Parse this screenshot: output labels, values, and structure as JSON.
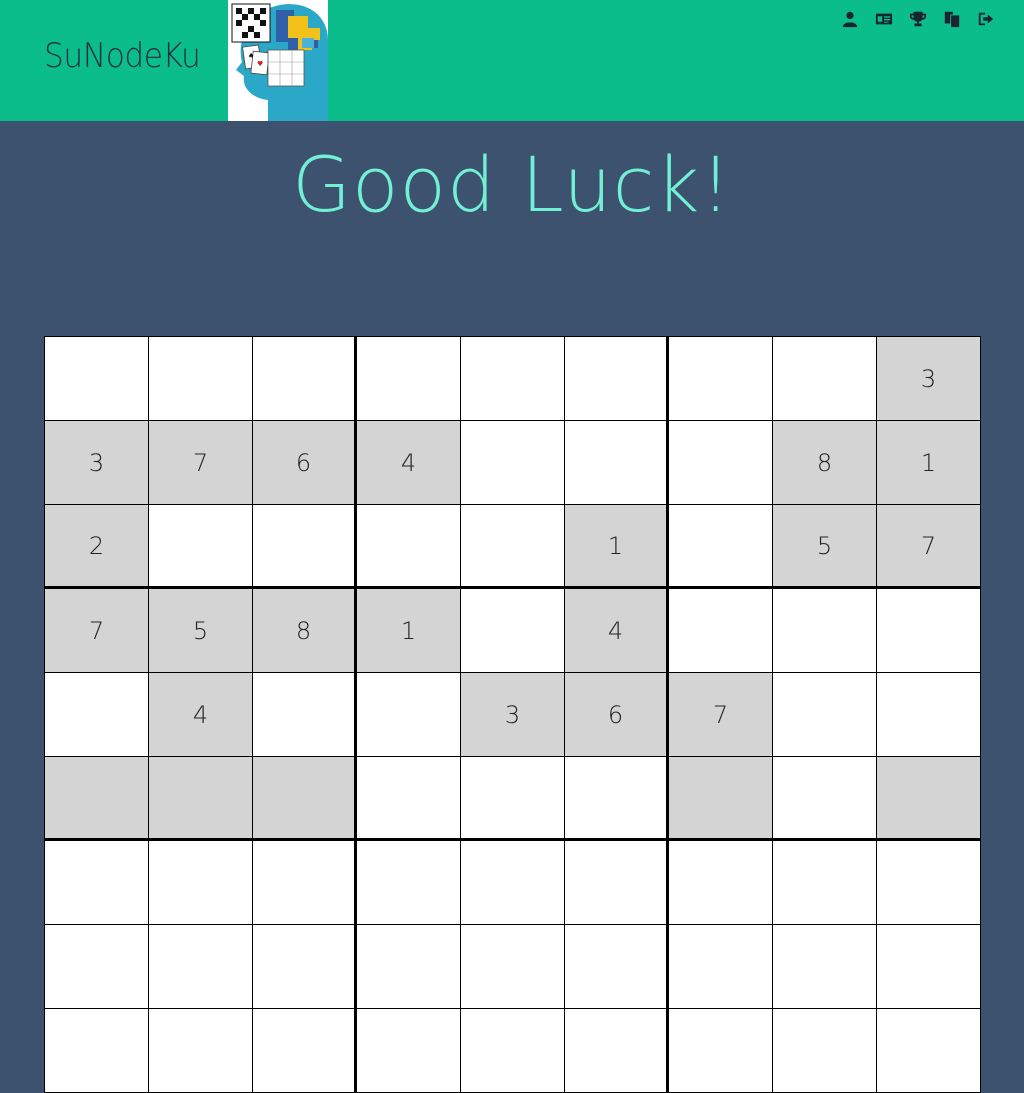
{
  "header": {
    "brand": "SuNodeKu",
    "logo_alt": "puzzle-head-logo",
    "nav_icons": [
      "user-icon",
      "id-card-icon",
      "trophy-icon",
      "copy-icon",
      "sign-out-icon"
    ],
    "background": "#0abd8b"
  },
  "main": {
    "title": "Good Luck!",
    "title_color": "#72f0d4",
    "background": "#3d526e"
  },
  "board": {
    "given_color": "#d4d4d4",
    "rows": [
      [
        "",
        "",
        "",
        "",
        "",
        "",
        "",
        "",
        "3"
      ],
      [
        "3",
        "7",
        "6",
        "4",
        "",
        "",
        "",
        "8",
        "1"
      ],
      [
        "2",
        "",
        "",
        "",
        "",
        "1",
        "",
        "5",
        "7"
      ],
      [
        "7",
        "5",
        "8",
        "1",
        "",
        "4",
        "",
        "",
        ""
      ],
      [
        "",
        "4",
        "",
        "",
        "3",
        "6",
        "7",
        "",
        ""
      ],
      [
        "",
        "",
        "",
        "",
        "",
        "",
        "",
        "",
        ""
      ],
      [
        "",
        "",
        "",
        "",
        "",
        "",
        "",
        "",
        ""
      ],
      [
        "",
        "",
        "",
        "",
        "",
        "",
        "",
        "",
        ""
      ],
      [
        "",
        "",
        "",
        "",
        "",
        "",
        "",
        "",
        ""
      ]
    ],
    "given": [
      [
        false,
        false,
        false,
        false,
        false,
        false,
        false,
        false,
        true
      ],
      [
        true,
        true,
        true,
        true,
        false,
        false,
        false,
        true,
        true
      ],
      [
        true,
        false,
        false,
        false,
        false,
        true,
        false,
        true,
        true
      ],
      [
        true,
        true,
        true,
        true,
        false,
        true,
        false,
        false,
        false
      ],
      [
        false,
        true,
        false,
        false,
        true,
        true,
        true,
        false,
        false
      ],
      [
        true,
        true,
        true,
        false,
        false,
        false,
        true,
        false,
        true
      ],
      [
        false,
        false,
        false,
        false,
        false,
        false,
        false,
        false,
        false
      ],
      [
        false,
        false,
        false,
        false,
        false,
        false,
        false,
        false,
        false
      ],
      [
        false,
        false,
        false,
        false,
        false,
        false,
        false,
        false,
        false
      ]
    ]
  }
}
